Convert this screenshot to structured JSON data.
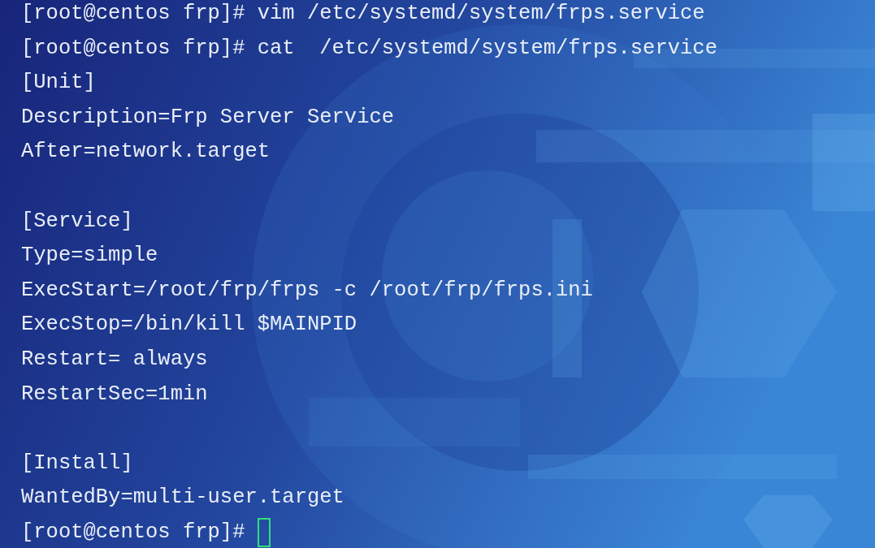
{
  "terminal": {
    "blocks": [
      [
        "[root@centos frp]# vim /etc/systemd/system/frps.service",
        "[root@centos frp]# cat  /etc/systemd/system/frps.service",
        "[Unit]",
        "Description=Frp Server Service",
        "After=network.target"
      ],
      [
        "[Service]",
        "Type=simple",
        "ExecStart=/root/frp/frps -c /root/frp/frps.ini",
        "ExecStop=/bin/kill $MAINPID",
        "Restart= always",
        "RestartSec=1min"
      ],
      [
        "[Install]",
        "WantedBy=multi-user.target",
        "[root@centos frp]# "
      ]
    ],
    "cursor_visible": true
  }
}
